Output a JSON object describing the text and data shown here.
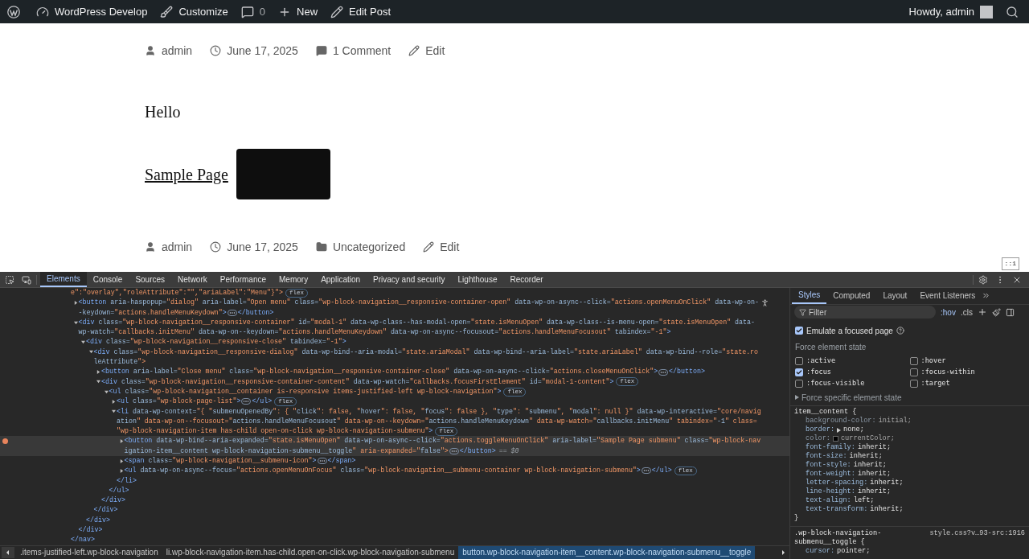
{
  "admin_bar": {
    "left": [
      {
        "kind": "site",
        "label": "WordPress Develop"
      },
      {
        "kind": "customize",
        "label": "Customize"
      },
      {
        "kind": "comments",
        "label": "0"
      },
      {
        "kind": "new",
        "label": "New"
      },
      {
        "kind": "edit",
        "label": "Edit Post"
      }
    ],
    "greeting": "Howdy, admin"
  },
  "post_top_meta": [
    {
      "kind": "author",
      "text": "admin"
    },
    {
      "kind": "date",
      "text": "June 17, 2025"
    },
    {
      "kind": "comments",
      "text": "1 Comment"
    },
    {
      "kind": "edit",
      "text": "Edit"
    }
  ],
  "content": {
    "paragraph": "Hello",
    "nav_link": "Sample Page",
    "toggle_focused": true
  },
  "post_bottom_meta": [
    {
      "kind": "author",
      "text": "admin"
    },
    {
      "kind": "date",
      "text": "June 17, 2025"
    },
    {
      "kind": "category",
      "text": "Uncategorized"
    },
    {
      "kind": "edit",
      "text": "Edit"
    }
  ],
  "dock_badge": "::1",
  "devtools": {
    "tabs": [
      {
        "label": "Elements",
        "selected": true
      },
      {
        "label": "Console",
        "selected": false
      },
      {
        "label": "Sources",
        "selected": false
      },
      {
        "label": "Network",
        "selected": false
      },
      {
        "label": "Performance",
        "selected": false
      },
      {
        "label": "Memory",
        "selected": false
      },
      {
        "label": "Application",
        "selected": false
      },
      {
        "label": "Privacy and security",
        "selected": false
      },
      {
        "label": "Lighthouse",
        "selected": false
      },
      {
        "label": "Recorder",
        "selected": false
      }
    ],
    "selected_suffix": "== $0",
    "dom_tree": [
      {
        "kind": "tail",
        "selected": false,
        "lines": [
          "e\":\"overlay\",\"roleAttribute\":\"\",\"ariaLabel\":\"Menu\"}\">"
        ],
        "badge": "flex",
        "children": [
          {
            "kind": "element",
            "selected": false,
            "expanded": false,
            "lines": [
              "<button aria-haspopup=\"dialog\" aria-label=\"Open menu\" class=\"wp-block-navigation__responsive-container-open\" data-wp-on-async--click=\"actions.openMenuOnClick\" data-wp-on-",
              "-keydown=\"actions.handleMenuKeydown\">"
            ],
            "closing": "</button>"
          },
          {
            "kind": "element",
            "selected": false,
            "expanded": true,
            "lines": [
              "<div class=\"wp-block-navigation__responsive-container\" id=\"modal-1\" data-wp-class--has-modal-open=\"state.isMenuOpen\" data-wp-class--is-menu-open=\"state.isMenuOpen\" data-",
              "wp-watch=\"callbacks.initMenu\" data-wp-on--keydown=\"actions.handleMenuKeydown\" data-wp-on-async--focusout=\"actions.handleMenuFocusout\" tabindex=\"-1\">"
            ],
            "children": [
              {
                "kind": "element",
                "selected": false,
                "expanded": true,
                "lines": [
                  "<div class=\"wp-block-navigation__responsive-close\" tabindex=\"-1\">"
                ],
                "children": [
                  {
                    "kind": "element",
                    "selected": false,
                    "expanded": true,
                    "lines": [
                      "<div class=\"wp-block-navigation__responsive-dialog\" data-wp-bind--aria-modal=\"state.ariaModal\" data-wp-bind--aria-label=\"state.ariaLabel\" data-wp-bind--role=\"state.ro",
                      "leAttribute\">"
                    ],
                    "children": [
                      {
                        "kind": "element",
                        "selected": false,
                        "expanded": false,
                        "lines": [
                          "<button aria-label=\"Close menu\" class=\"wp-block-navigation__responsive-container-close\" data-wp-on-async--click=\"actions.closeMenuOnClick\">"
                        ],
                        "closing": "</button>"
                      },
                      {
                        "kind": "element",
                        "selected": false,
                        "expanded": true,
                        "lines": [
                          "<div class=\"wp-block-navigation__responsive-container-content\" data-wp-watch=\"callbacks.focusFirstElement\" id=\"modal-1-content\">"
                        ],
                        "badge": "flex",
                        "children": [
                          {
                            "kind": "element",
                            "selected": false,
                            "expanded": true,
                            "lines": [
                              "<ul class=\"wp-block-navigation__container is-responsive items-justified-left wp-block-navigation\">"
                            ],
                            "badge": "flex",
                            "children": [
                              {
                                "kind": "element",
                                "selected": false,
                                "expanded": false,
                                "lines": [
                                  "<ul class=\"wp-block-page-list\">"
                                ],
                                "closing": "</ul>",
                                "badge": "flex"
                              },
                              {
                                "kind": "element",
                                "selected": false,
                                "expanded": true,
                                "lines": [
                                  "<li data-wp-context=\"{ \"submenuOpenedBy\": { \"click\": false, \"hover\": false, \"focus\": false }, \"type\": \"submenu\", \"modal\": null }\" data-wp-interactive=\"core/navig",
                                  "ation\" data-wp-on--focusout=\"actions.handleMenuFocusout\" data-wp-on--keydown=\"actions.handleMenuKeydown\" data-wp-watch=\"callbacks.initMenu\" tabindex=\"-1\" class=",
                                  "\"wp-block-navigation-item has-child open-on-click wp-block-navigation-submenu\">"
                                ],
                                "badge": "flex",
                                "children": [
                                  {
                                    "kind": "element",
                                    "selected": true,
                                    "expanded": false,
                                    "lines": [
                                      "<button data-wp-bind--aria-expanded=\"state.isMenuOpen\" data-wp-on-async--click=\"actions.toggleMenuOnClick\" aria-label=\"Sample Page submenu\" class=\"wp-block-nav",
                                      "igation-item__content wp-block-navigation-submenu__toggle\" aria-expanded=\"false\">"
                                    ],
                                    "closing": "</button>"
                                  },
                                  {
                                    "kind": "element",
                                    "selected": false,
                                    "expanded": false,
                                    "lines": [
                                      "<span class=\"wp-block-navigation__submenu-icon\">"
                                    ],
                                    "closing": "</span>"
                                  },
                                  {
                                    "kind": "element",
                                    "selected": false,
                                    "expanded": false,
                                    "lines": [
                                      "<ul data-wp-on-async--focus=\"actions.openMenuOnFocus\" class=\"wp-block-navigation__submenu-container wp-block-navigation-submenu\">"
                                    ],
                                    "closing": "</ul>",
                                    "badge": "flex"
                                  },
                                  {
                                    "kind": "close",
                                    "selected": false,
                                    "text": "</li>"
                                  }
                                ]
                              },
                              {
                                "kind": "close",
                                "selected": false,
                                "text": "</ul>"
                              }
                            ]
                          },
                          {
                            "kind": "close",
                            "selected": false,
                            "text": "</div>"
                          }
                        ]
                      },
                      {
                        "kind": "close",
                        "selected": false,
                        "text": "</div>"
                      }
                    ]
                  },
                  {
                    "kind": "close",
                    "selected": false,
                    "text": "</div>"
                  }
                ]
              },
              {
                "kind": "close",
                "selected": false,
                "text": "</div>"
              }
            ]
          },
          {
            "kind": "close",
            "selected": false,
            "text": "</nav>"
          }
        ]
      }
    ],
    "breadcrumbs": [
      {
        "text": ".items-justified-left.wp-block-navigation",
        "selected": false
      },
      {
        "text": "li.wp-block-navigation-item.has-child.open-on-click.wp-block-navigation-submenu",
        "selected": false
      },
      {
        "text": "button.wp-block-navigation-item__content.wp-block-navigation-submenu__toggle",
        "selected": true
      }
    ],
    "styles": {
      "tabs": [
        {
          "label": "Styles",
          "selected": true
        },
        {
          "label": "Computed",
          "selected": false
        },
        {
          "label": "Layout",
          "selected": false
        },
        {
          "label": "Event Listeners",
          "selected": false
        }
      ],
      "filter_placeholder": "Filter",
      "hov": ":hov",
      "cls": ".cls",
      "emulate_focus": {
        "label": "Emulate a focused page",
        "checked": true
      },
      "force_title": "Force element state",
      "states": [
        {
          "label": ":active",
          "checked": false
        },
        {
          "label": ":hover",
          "checked": false
        },
        {
          "label": ":focus",
          "checked": true
        },
        {
          "label": ":focus-within",
          "checked": false
        },
        {
          "label": ":focus-visible",
          "checked": false
        },
        {
          "label": ":target",
          "checked": false
        }
      ],
      "specific_state": "Force specific element state",
      "rules": [
        {
          "selector": [
            "item__content {"
          ],
          "declarations": [
            {
              "property": "background-color:",
              "value": "initial;",
              "struck": true
            },
            {
              "property": "border:",
              "value": "none;",
              "struck": false,
              "expandable": true
            },
            {
              "property": "color:",
              "value": "currentColor;",
              "struck": true,
              "swatch": true
            },
            {
              "property": "font-family:",
              "value": "inherit;",
              "struck": false
            },
            {
              "property": "font-size:",
              "value": "inherit;",
              "struck": false
            },
            {
              "property": "font-style:",
              "value": "inherit;",
              "struck": false
            },
            {
              "property": "font-weight:",
              "value": "inherit;",
              "struck": false
            },
            {
              "property": "letter-spacing:",
              "value": "inherit;",
              "struck": false
            },
            {
              "property": "line-height:",
              "value": "inherit;",
              "struck": false
            },
            {
              "property": "text-align:",
              "value": "left;",
              "struck": false
            },
            {
              "property": "text-transform:",
              "value": "inherit;",
              "struck": false
            }
          ],
          "close": "}"
        },
        {
          "selector": [
            ".wp-block-navigation-",
            "submenu__toggle {"
          ],
          "source": "style.css?v…93-src:1916",
          "declarations": [
            {
              "property": "cursor:",
              "value": "pointer;",
              "struck": false
            }
          ]
        }
      ]
    }
  }
}
